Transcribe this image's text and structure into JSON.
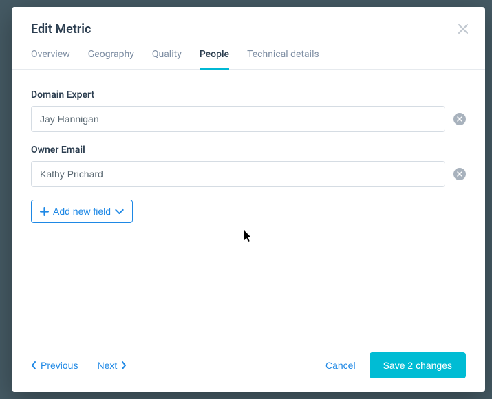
{
  "modal": {
    "title": "Edit Metric"
  },
  "tabs": [
    {
      "label": "Overview",
      "active": false
    },
    {
      "label": "Geography",
      "active": false
    },
    {
      "label": "Quality",
      "active": false
    },
    {
      "label": "People",
      "active": true
    },
    {
      "label": "Technical details",
      "active": false
    }
  ],
  "fields": [
    {
      "label": "Domain Expert",
      "value": "Jay Hannigan"
    },
    {
      "label": "Owner Email",
      "value": "Kathy Prichard"
    }
  ],
  "buttons": {
    "add_field": "Add new field",
    "previous": "Previous",
    "next": "Next",
    "cancel": "Cancel",
    "save": "Save 2 changes"
  }
}
